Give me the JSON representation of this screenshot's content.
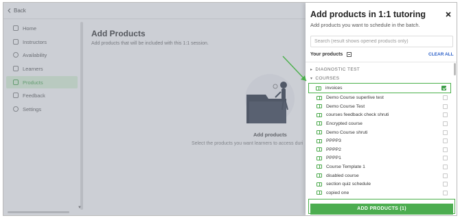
{
  "app": {
    "back_label": "Back",
    "sidebar": [
      {
        "label": "Home",
        "icon": "home-icon",
        "active": false
      },
      {
        "label": "Instructors",
        "icon": "instructors-icon",
        "active": false
      },
      {
        "label": "Availability",
        "icon": "clock-icon",
        "active": false
      },
      {
        "label": "Learners",
        "icon": "person-icon",
        "active": false
      },
      {
        "label": "Products",
        "icon": "products-icon",
        "active": true
      },
      {
        "label": "Feedback",
        "icon": "feedback-icon",
        "active": false
      },
      {
        "label": "Settings",
        "icon": "gear-icon",
        "active": false
      }
    ],
    "page_title": "Add Products",
    "page_subtitle": "Add products that will be included with this 1:1 session.",
    "empty_title": "Add products",
    "empty_subtitle": "Select the products you want learners to access duri"
  },
  "drawer": {
    "title": "Add products in 1:1 tutoring",
    "subtitle": "Add products you want to schedule in the batch.",
    "search_placeholder": "Search (result shows opened products only)",
    "your_products_label": "Your products",
    "clear_all_label": "CLEAR ALL",
    "sections": [
      {
        "label": "DIAGNOSTIC TEST",
        "expanded": false
      },
      {
        "label": "COURSES",
        "expanded": true
      }
    ],
    "items": [
      {
        "label": "invoices",
        "checked": true
      },
      {
        "label": "Demo Course superlive test",
        "checked": false
      },
      {
        "label": "Demo Course Test",
        "checked": false
      },
      {
        "label": "courses feedback check shruti",
        "checked": false
      },
      {
        "label": "Encrypted course",
        "checked": false
      },
      {
        "label": "Demo Course shruti",
        "checked": false
      },
      {
        "label": "PPPP3",
        "checked": false
      },
      {
        "label": "PPPP2",
        "checked": false
      },
      {
        "label": "PPPP1",
        "checked": false
      },
      {
        "label": "Course Template 1",
        "checked": false
      },
      {
        "label": "disabled course",
        "checked": false
      },
      {
        "label": "section quiz schedule",
        "checked": false
      },
      {
        "label": "copied one",
        "checked": false
      }
    ],
    "add_button_label": "ADD PRODUCTS (1)"
  },
  "colors": {
    "accent_green": "#4cad50",
    "link_blue": "#2a5fc8",
    "annotation_green": "#4ab04a"
  }
}
